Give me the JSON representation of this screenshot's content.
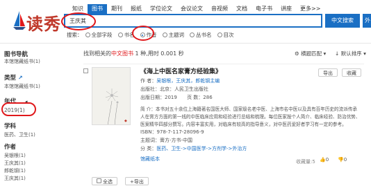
{
  "logo": {
    "text": "读秀"
  },
  "nav": [
    "知识",
    "图书",
    "期刊",
    "报纸",
    "学位论文",
    "会议论文",
    "音视频",
    "文档",
    "电子书",
    "讲座",
    "更多>>"
  ],
  "search": {
    "value": "王庆其",
    "btn_primary": "中文搜索",
    "btn_secondary": "外"
  },
  "scope": {
    "label": "搜索：",
    "options": [
      "全部字段",
      "书名",
      "作者",
      "主题词",
      "丛书名",
      "目次"
    ],
    "selected": 2
  },
  "sidebar": {
    "nav_title": "图书导航",
    "nav_sub": "本馆馆藏纸书(1)",
    "type_title": "类型",
    "type_sub": "本馆馆藏纸书(1)",
    "year_title": "年代",
    "year_item": "2019(1)",
    "subject_title": "学科",
    "subject_item": "医药、卫生(1)",
    "author_title": "作者",
    "author_items": [
      "吴银根(1)",
      "王庆其(1)",
      "郎乾钢(1)",
      "王庆其(1)"
    ]
  },
  "result": {
    "prefix": "找到相关的",
    "highlight": "中文图书",
    "suffix": "1 种,用时 0.001 秒"
  },
  "sort": {
    "match": "横题匹配",
    "sort": "默认排序"
  },
  "book": {
    "title": "《海上中医名家膏方经验集》",
    "author_label": "作 者：",
    "authors": "吴银根，王庆其，郎乾钢主编",
    "publisher": "出版社：北京：人民卫生出版社",
    "date": "出版日期：2019",
    "pages": "页 数：286",
    "desc": "简 介：本书对五十余位上海籍著名国医大师、国家级名老中医、上海市名中医以及具有百年历史的流派传承人在膏方方面的第一线的中医临床应用和经验进行总结和梳理。每位医家按个人简介、临床经验、防治优势、医案精华四部分撰写。内容丰富实用，对临床有较高的指导意义，对中医药爱好者学习有一定的参考。",
    "isbn": "ISBN：978-7-117-28096-9",
    "subject": "主题词：膏方-方书-中国",
    "class_label": "分 类：",
    "class_path": "医药、卫生->中国医学->方剂学->外治方",
    "paper_link": "馆藏纸本",
    "btn_export": "导出",
    "btn_fav": "收藏",
    "fav_count": "收藏量:5",
    "likes": "0",
    "dislikes": "0"
  },
  "bottom": {
    "btn1": "全选",
    "btn2": "导出"
  }
}
